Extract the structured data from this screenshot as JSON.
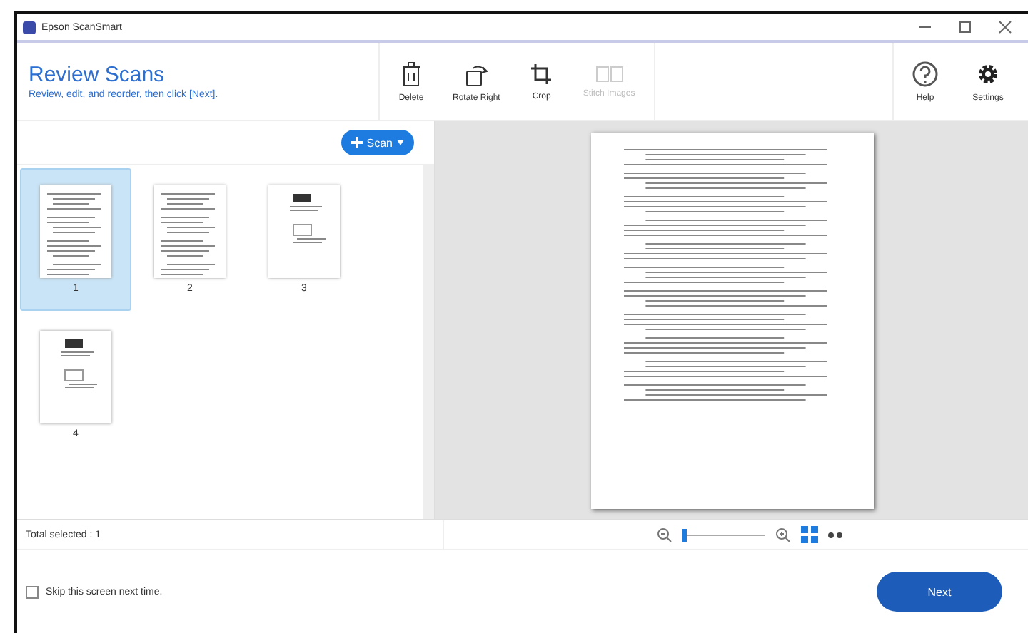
{
  "window": {
    "title": "Epson ScanSmart"
  },
  "header": {
    "title": "Review Scans",
    "subtitle": "Review, edit, and reorder, then click [Next]."
  },
  "toolbar": [
    {
      "label": "Delete",
      "kind": "delete",
      "disabled": false
    },
    {
      "label": "Rotate Right",
      "kind": "rotate",
      "disabled": false
    },
    {
      "label": "Crop",
      "kind": "crop",
      "disabled": false
    },
    {
      "label": "Stitch Images",
      "kind": "stitch",
      "disabled": true
    }
  ],
  "side_tools": [
    {
      "label": "Help",
      "kind": "help"
    },
    {
      "label": "Settings",
      "kind": "settings"
    }
  ],
  "scan_button": "Scan",
  "thumbnails": [
    {
      "label": "1",
      "kind": "text",
      "selected": true
    },
    {
      "label": "2",
      "kind": "text",
      "selected": false
    },
    {
      "label": "3",
      "kind": "figures",
      "selected": false
    },
    {
      "label": "4",
      "kind": "figures",
      "selected": false
    }
  ],
  "status": {
    "total_selected": "Total selected : 1"
  },
  "zoom": {
    "level": 0.03
  },
  "footer": {
    "skip_checkbox": {
      "label": "Skip this screen next time.",
      "checked": false
    },
    "next_button": "Next"
  }
}
